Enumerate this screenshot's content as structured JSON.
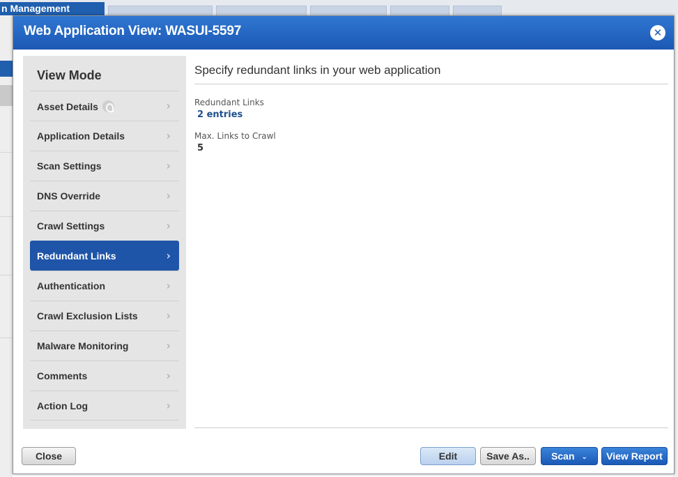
{
  "background": {
    "app_title": "n Management"
  },
  "modal": {
    "title": "Web Application View: WASUI-5597",
    "close_icon": "close-icon"
  },
  "sidebar": {
    "title": "View Mode",
    "items": [
      {
        "label": "Asset Details",
        "active": false,
        "badge": true
      },
      {
        "label": "Application Details",
        "active": false
      },
      {
        "label": "Scan Settings",
        "active": false
      },
      {
        "label": "DNS Override",
        "active": false
      },
      {
        "label": "Crawl Settings",
        "active": false
      },
      {
        "label": "Redundant Links",
        "active": true
      },
      {
        "label": "Authentication",
        "active": false
      },
      {
        "label": "Crawl Exclusion Lists",
        "active": false
      },
      {
        "label": "Malware Monitoring",
        "active": false
      },
      {
        "label": "Comments",
        "active": false
      },
      {
        "label": "Action Log",
        "active": false
      }
    ],
    "chevron": "›"
  },
  "content": {
    "heading": "Specify redundant links in your web application",
    "redundant_links_label": "Redundant Links",
    "redundant_links_value": "2 entries",
    "max_links_label": "Max. Links to Crawl",
    "max_links_value": "5"
  },
  "footer": {
    "close": "Close",
    "edit": "Edit",
    "save_as": "Save As..",
    "scan": "Scan",
    "scan_caret": "⌄",
    "view_report": "View Report"
  },
  "colors": {
    "header": "#1c58b4",
    "active_nav": "#1f55a8",
    "link": "#1f4f8f"
  }
}
